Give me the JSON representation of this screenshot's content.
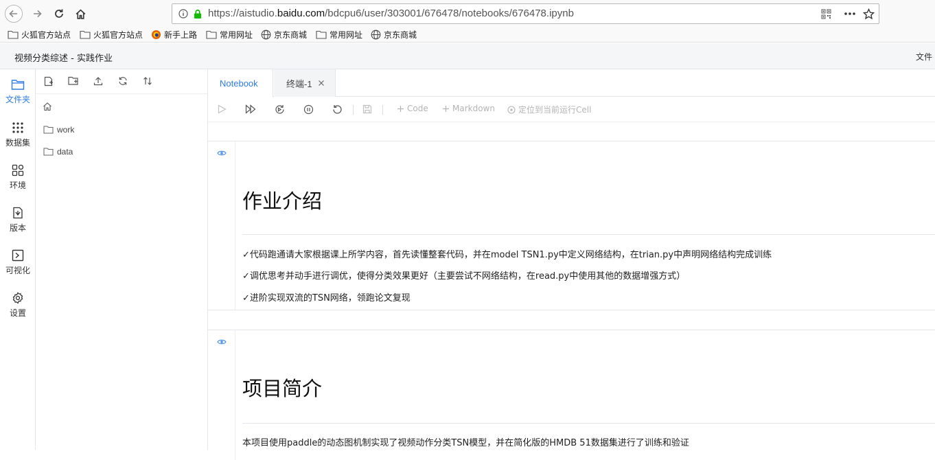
{
  "browser": {
    "url_prefix": "https://aistudio.",
    "url_domain": "baidu.com",
    "url_path": "/bdcpu6/user/303001/676478/notebooks/676478.ipynb"
  },
  "bookmarks": [
    {
      "label": "火狐官方站点",
      "icon": "folder-icon"
    },
    {
      "label": "火狐官方站点",
      "icon": "folder-icon"
    },
    {
      "label": "新手上路",
      "icon": "firefox-icon"
    },
    {
      "label": "常用网址",
      "icon": "folder-icon"
    },
    {
      "label": "京东商城",
      "icon": "globe-icon"
    },
    {
      "label": "常用网址",
      "icon": "folder-icon"
    },
    {
      "label": "京东商城",
      "icon": "globe-icon"
    }
  ],
  "app": {
    "title": "视频分类综述 - 实践作业",
    "file_menu": "文件"
  },
  "rail": [
    {
      "label": "文件夹",
      "icon": "folder-icon",
      "active": true
    },
    {
      "label": "数据集",
      "icon": "dataset-grid-icon",
      "active": false
    },
    {
      "label": "环境",
      "icon": "environment-icon",
      "active": false
    },
    {
      "label": "版本",
      "icon": "version-icon",
      "active": false
    },
    {
      "label": "可视化",
      "icon": "visualization-icon",
      "active": false
    },
    {
      "label": "设置",
      "icon": "settings-gear-icon",
      "active": false
    }
  ],
  "files": [
    {
      "name": "work",
      "icon": "folder-icon"
    },
    {
      "name": "data",
      "icon": "folder-icon"
    }
  ],
  "tabs": {
    "notebook": "Notebook",
    "terminal": "终端-1"
  },
  "toolbar": {
    "add_code": "Code",
    "add_markdown": "Markdown",
    "locate_cell": "定位到当前运行Cell"
  },
  "cells": [
    {
      "heading": "作业介绍",
      "lines": [
        "✓代码跑通请大家根据课上所学内容，首先读懂整套代码，并在model TSN1.py中定义网络结构，在trian.py中声明网络结构完成训练",
        "✓调优思考并动手进行调优，使得分类效果更好（主要尝试不网络结构，在read.py中使用其他的数据增强方式）",
        "✓进阶实现双流的TSN网络，领跑论文复现"
      ]
    },
    {
      "heading": "项目简介",
      "lines": [
        "本项目使用paddle的动态图机制实现了视频动作分类TSN模型，并在简化版的HMDB 51数据集进行了训练和验证"
      ]
    }
  ],
  "colors": {
    "accent": "#2d7be5",
    "eye": "#4a8fe3"
  }
}
